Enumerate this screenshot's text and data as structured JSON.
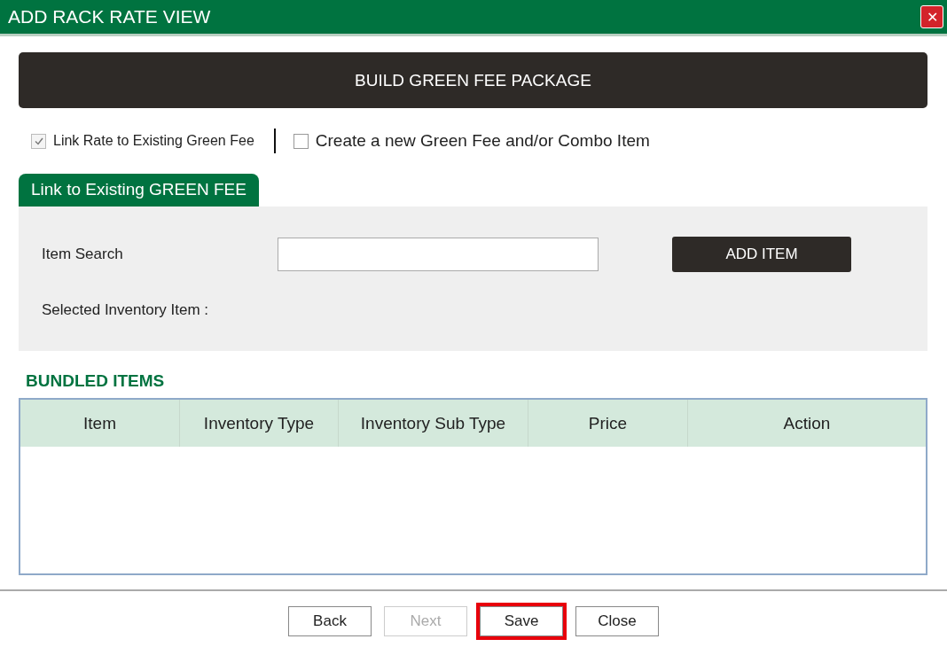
{
  "window": {
    "title": "ADD RACK RATE VIEW",
    "close_icon": "✕"
  },
  "banner": "BUILD GREEN FEE PACKAGE",
  "options": [
    {
      "label": "Link Rate to Existing Green Fee",
      "checked": true,
      "disabled": true
    },
    {
      "label": "Create a new Green Fee and/or Combo Item",
      "checked": false,
      "disabled": false
    }
  ],
  "section_tab": "Link to Existing GREEN FEE",
  "item_search": {
    "label": "Item Search"
  },
  "add_item_button": "ADD ITEM",
  "selected_label": "Selected Inventory Item :",
  "bundled": {
    "title": "BUNDLED ITEMS",
    "columns": [
      "Item",
      "Inventory Type",
      "Inventory Sub Type",
      "Price",
      "Action"
    ]
  },
  "footer_buttons": [
    {
      "label": "Back",
      "disabled": false,
      "highlighted": false
    },
    {
      "label": "Next",
      "disabled": true,
      "highlighted": false
    },
    {
      "label": "Save",
      "disabled": false,
      "highlighted": true
    },
    {
      "label": "Close",
      "disabled": false,
      "highlighted": false
    }
  ]
}
